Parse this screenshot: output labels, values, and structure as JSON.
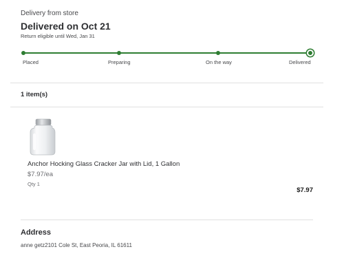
{
  "order": {
    "fulfillment_type": "Delivery from store",
    "status_headline": "Delivered on Oct 21",
    "return_note": "Return eligible until Wed, Jan 31",
    "progress_color": "#2e7d32",
    "steps": [
      {
        "label": "Placed",
        "completed": true,
        "current": false
      },
      {
        "label": "Preparing",
        "completed": true,
        "current": false
      },
      {
        "label": "On the way",
        "completed": true,
        "current": false
      },
      {
        "label": "Delivered",
        "completed": true,
        "current": true
      }
    ]
  },
  "items": {
    "count_label": "1 item(s)",
    "list": [
      {
        "name": "Anchor Hocking Glass Cracker Jar with Lid, 1 Gallon",
        "unit_price": "$7.97/ea",
        "quantity": "Qty 1",
        "total": "$7.97",
        "image_icon": "glass-jar-icon"
      }
    ]
  },
  "address": {
    "heading": "Address",
    "text": "anne getz2101 Cole St, East Peoria, IL 61611"
  }
}
